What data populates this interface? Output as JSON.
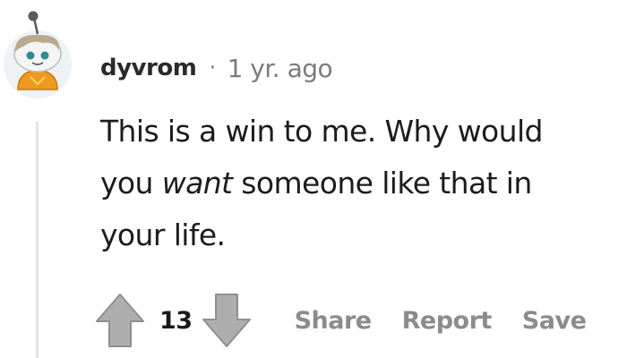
{
  "comment": {
    "author": "dyvrom",
    "separator": "·",
    "age": "1 yr. ago",
    "body": {
      "line1": "This is a win to me. Why would",
      "line2_before": "you ",
      "line2_emphasis": "want",
      "line2_after": " someone like that in",
      "line3": "your life."
    },
    "score": "13",
    "actions": {
      "share": "Share",
      "report": "Report",
      "save": "Save"
    }
  },
  "icons": {
    "avatar": "snoo-avatar-icon",
    "upvote": "upvote-arrow-icon",
    "downvote": "downvote-arrow-icon"
  },
  "colors": {
    "arrow_fill": "#aeaeae",
    "arrow_stroke": "#8f8f8f",
    "avatar_hoodie": "#ee9a1f",
    "avatar_hair": "#b9a98f",
    "thread_line": "#e3e3e3",
    "muted_text": "#8c8c8c"
  }
}
